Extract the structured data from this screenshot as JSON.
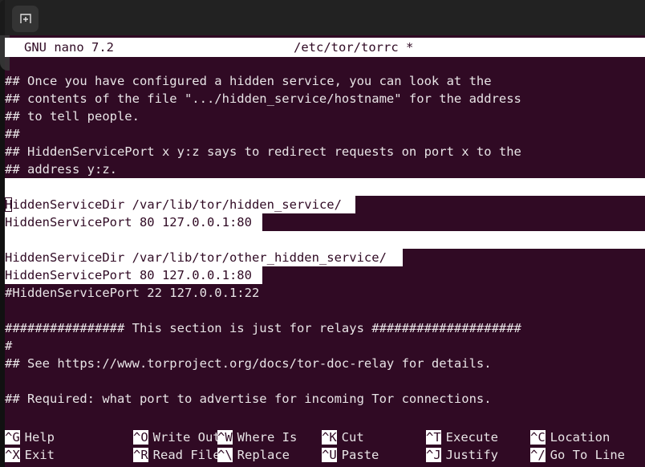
{
  "window": {
    "tabbar": {
      "new_tab_icon": "new-terminal-tab-icon"
    }
  },
  "editor": {
    "title_left": "GNU nano 7.2",
    "title_file": "/etc/tor/torrc *",
    "lines": [
      {
        "text": "## Once you have configured a hidden service, you can look at the",
        "selected": false
      },
      {
        "text": "## contents of the file \".../hidden_service/hostname\" for the address",
        "selected": false
      },
      {
        "text": "## to tell people.",
        "selected": false
      },
      {
        "text": "##",
        "selected": false
      },
      {
        "text": "## HiddenServicePort x y:z says to redirect requests on port x to the",
        "selected": false
      },
      {
        "text": "## address y:z.",
        "selected": false
      },
      {
        "text": "",
        "selected": true
      },
      {
        "text": "HiddenServiceDir /var/lib/tor/hidden_service/",
        "selected": true
      },
      {
        "text": "HiddenServicePort 80 127.0.0.1:80",
        "selected": true
      },
      {
        "text": "",
        "selected": true
      },
      {
        "text": "HiddenServiceDir /var/lib/tor/other_hidden_service/",
        "selected": true
      },
      {
        "text": "HiddenServicePort 80 127.0.0.1:80",
        "selected": true
      },
      {
        "text": "#HiddenServicePort 22 127.0.0.1:22",
        "selected": false
      },
      {
        "text": "",
        "selected": false
      },
      {
        "text": "################ This section is just for relays ####################",
        "selected": false
      },
      {
        "text": "#",
        "selected": false
      },
      {
        "text": "## See https://www.torproject.org/docs/tor-doc-relay for details.",
        "selected": false
      },
      {
        "text": "",
        "selected": false
      },
      {
        "text": "## Required: what port to advertise for incoming Tor connections.",
        "selected": false
      }
    ],
    "cursor": {
      "line_index": 7,
      "char": "H",
      "column": 0
    }
  },
  "shortcuts": {
    "row1": [
      {
        "key": "^G",
        "label": "Help"
      },
      {
        "key": "^O",
        "label": "Write Out"
      },
      {
        "key": "^W",
        "label": "Where Is"
      },
      {
        "key": "^K",
        "label": "Cut"
      },
      {
        "key": "^T",
        "label": "Execute"
      },
      {
        "key": "^C",
        "label": "Location"
      }
    ],
    "row2": [
      {
        "key": "^X",
        "label": "Exit"
      },
      {
        "key": "^R",
        "label": "Read File"
      },
      {
        "key": "^\\",
        "label": "Replace"
      },
      {
        "key": "^U",
        "label": "Paste"
      },
      {
        "key": "^J",
        "label": "Justify"
      },
      {
        "key": "^/",
        "label": "Go To Line"
      }
    ]
  },
  "colors": {
    "terminal_bg": "#300a24",
    "terminal_fg": "#e8e4e6",
    "inverse_bg": "#ffffff",
    "inverse_fg": "#300a24",
    "tabbar_bg": "#222222",
    "tab_button_bg": "#343434"
  }
}
